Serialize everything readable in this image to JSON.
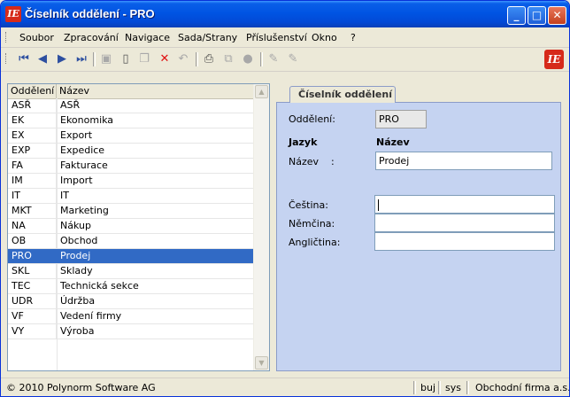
{
  "window": {
    "title": "Číselník oddělení - PRO",
    "app_icon": "IE-logo-icon",
    "minimize": "_",
    "maximize": "□",
    "close": "✕"
  },
  "menu": [
    "Soubor",
    "Zpracování",
    "Navigace",
    "Sada/Strany",
    "Příslušenství",
    "Okno",
    "?"
  ],
  "toolbar": {
    "icons": [
      "first-record-icon",
      "previous-record-icon",
      "next-record-icon",
      "last-record-icon",
      "save-icon",
      "new-icon",
      "copy-icon",
      "delete-icon",
      "undo-icon",
      "print-icon",
      "tree-icon",
      "stop-icon",
      "edit-icon",
      "edit-alt-icon"
    ]
  },
  "list": {
    "headers": [
      "Oddělení",
      "Název"
    ],
    "rows": [
      [
        "ASŘ",
        "ASŘ"
      ],
      [
        "EK",
        "Ekonomika"
      ],
      [
        "EX",
        "Export"
      ],
      [
        "EXP",
        "Expedice"
      ],
      [
        "FA",
        "Fakturace"
      ],
      [
        "IM",
        "Import"
      ],
      [
        "IT",
        "IT"
      ],
      [
        "MKT",
        "Marketing"
      ],
      [
        "NA",
        "Nákup"
      ],
      [
        "OB",
        "Obchod"
      ],
      [
        "PRO",
        "Prodej"
      ],
      [
        "SKL",
        "Sklady"
      ],
      [
        "TEC",
        "Technická sekce"
      ],
      [
        "UDR",
        "Údržba"
      ],
      [
        "VF",
        "Vedení firmy"
      ],
      [
        "VY",
        "Výroba"
      ]
    ],
    "selected_index": 10
  },
  "form": {
    "tab": "Číselník oddělení",
    "oddeleni_label": "Oddělení:",
    "oddeleni_value": "PRO",
    "jazyk_label": "Jazyk",
    "nazev_header": "Název",
    "nazev_label": "Název",
    "nazev_colon": ":",
    "nazev_value": "Prodej",
    "cestina_label": "Čeština:",
    "cestina_value": "",
    "nemcina_label": "Němčina:",
    "nemcina_value": "",
    "anglictina_label": "Angličtina:",
    "anglictina_value": ""
  },
  "status": {
    "copyright": "© 2010 Polynorm Software AG",
    "user": "buj",
    "db": "sys",
    "company": "Obchodní firma a.s."
  }
}
